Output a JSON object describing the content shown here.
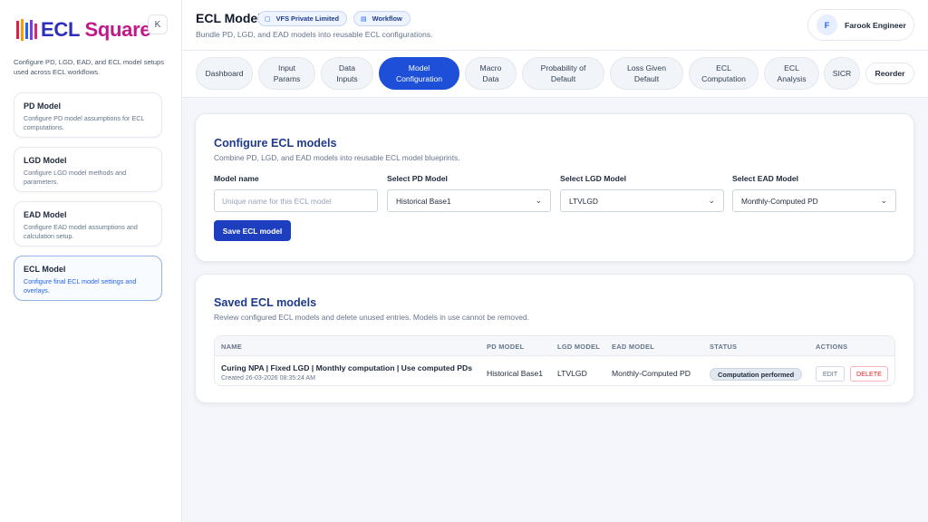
{
  "app": {
    "logo_text": "ECL",
    "logo_text_accent": "Square",
    "collapse_label": "K",
    "brand_colors": [
      "#e11d48",
      "#f59e0b",
      "#2563eb",
      "#7c3aed",
      "#db2777"
    ]
  },
  "sidebar": {
    "description": "Configure PD, LGD, EAD, and ECL model setups used across ECL workflows.",
    "items": [
      {
        "title": "PD Model",
        "desc": "Configure PD model assumptions for ECL computations."
      },
      {
        "title": "LGD Model",
        "desc": "Configure LGD model methods and parameters."
      },
      {
        "title": "EAD Model",
        "desc": "Configure EAD model assumptions and calculation setup."
      },
      {
        "title": "ECL Model",
        "desc": "Configure final ECL model settings and overlays.",
        "active": true
      }
    ]
  },
  "header": {
    "title": "ECL Model",
    "subtitle": "Bundle PD, LGD, and EAD models into reusable ECL configurations.",
    "pills": [
      {
        "label": "VFS Private Limited",
        "icon": "building-icon"
      },
      {
        "label": "Workflow",
        "icon": "workflow-icon"
      }
    ],
    "user": {
      "initial": "F",
      "name": "Farook Engineer"
    }
  },
  "tabs": [
    {
      "label": "Dashboard"
    },
    {
      "label": "Input Params"
    },
    {
      "label": "Data Inputs"
    },
    {
      "label": "Model Configuration",
      "active": true
    },
    {
      "label": "Macro Data"
    },
    {
      "label": "Probability of Default"
    },
    {
      "label": "Loss Given Default"
    },
    {
      "label": "ECL Computation"
    },
    {
      "label": "ECL Analysis"
    },
    {
      "label": "SICR"
    },
    {
      "label": "Reorder"
    }
  ],
  "configure": {
    "title": "Configure ECL models",
    "subtitle": "Combine PD, LGD, and EAD models into reusable ECL model blueprints.",
    "model_name_label": "Model name",
    "model_name_placeholder": "Unique name for this ECL model",
    "model_name_value": "",
    "pd_label": "Select PD Model",
    "pd_value": "Historical Base1",
    "lgd_label": "Select LGD Model",
    "lgd_value": "LTVLGD",
    "ead_label": "Select EAD Model",
    "ead_value": "Monthly-Computed PD",
    "save_label": "Save ECL model"
  },
  "saved": {
    "title": "Saved ECL models",
    "subtitle": "Review configured ECL models and delete unused entries. Models in use cannot be removed.",
    "columns": [
      "NAME",
      "PD MODEL",
      "LGD MODEL",
      "EAD MODEL",
      "STATUS",
      "ACTIONS"
    ],
    "rows": [
      {
        "name": "Curing NPA | Fixed LGD | Monthly computation | Use computed PDs",
        "created": "Created 26-03-2026 08:35:24 AM",
        "pd": "Historical Base1",
        "lgd": "LTVLGD",
        "ead": "Monthly-Computed PD",
        "status": "Computation performed",
        "edit": "EDIT",
        "delete": "DELETE"
      }
    ]
  }
}
